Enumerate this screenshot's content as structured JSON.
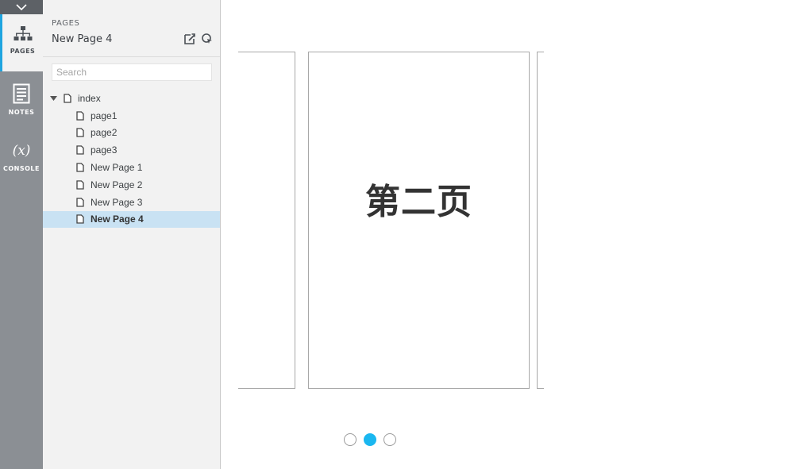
{
  "rail": {
    "tabs": [
      {
        "label": "PAGES",
        "icon": "sitemap-icon",
        "active": true
      },
      {
        "label": "NOTES",
        "icon": "notes-icon",
        "active": false
      },
      {
        "label": "CONSOLE",
        "icon": "variable-icon",
        "active": false
      }
    ]
  },
  "panel": {
    "kicker": "PAGES",
    "title": "New Page 4",
    "search_placeholder": "Search"
  },
  "tree": {
    "root": "index",
    "children": [
      "page1",
      "page2",
      "page3",
      "New Page 1",
      "New Page 2",
      "New Page 3",
      "New Page 4"
    ],
    "selected": "New Page 4"
  },
  "slide": {
    "text": "第二页"
  },
  "pagination": {
    "count": 3,
    "active": 2
  },
  "colors": {
    "accent": "#1ab7f0",
    "selected_row": "#c9e2f3",
    "rail": "#8b8f94"
  }
}
